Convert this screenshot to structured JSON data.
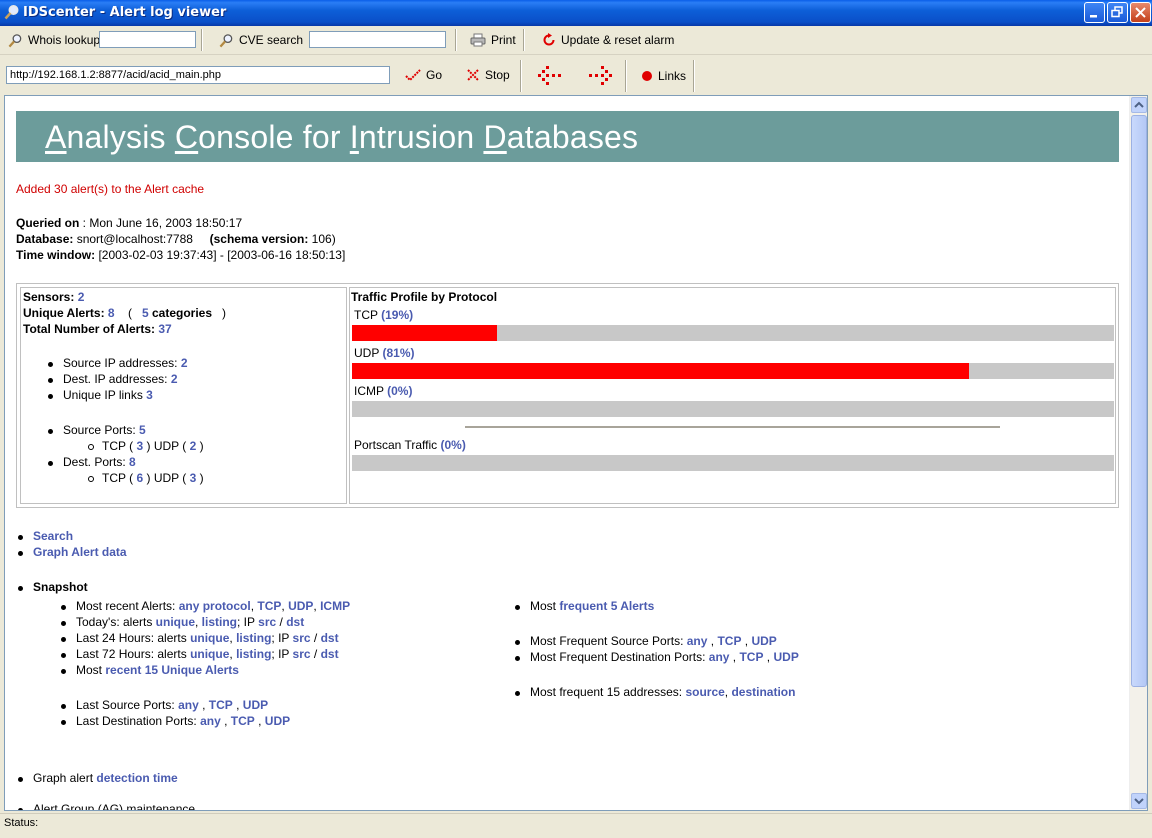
{
  "window": {
    "title": "IDScenter - Alert log viewer"
  },
  "toolbar1": {
    "whois_label": "Whois lookup",
    "whois_value": "",
    "cve_label": "CVE search",
    "cve_value": "",
    "print_label": "Print",
    "update_label": "Update & reset alarm"
  },
  "toolbar2": {
    "url": "http://192.168.1.2:8877/acid/acid_main.php",
    "go_label": "Go",
    "stop_label": "Stop",
    "links_label": "Links"
  },
  "acid": {
    "banner_title_parts": [
      "A",
      "nalysis ",
      "C",
      "onsole for ",
      "I",
      "ntrusion ",
      "D",
      "atabases"
    ],
    "cache_msg": "Added 30 alert(s) to the Alert cache",
    "queried_label": "Queried on",
    "queried_value": " : Mon June 16, 2003 18:50:17",
    "database_label": "Database:",
    "database_value": " snort@localhost:7788",
    "schema_label": "(schema version:",
    "schema_value": " 106)",
    "time_label": "Time window:",
    "time_value": " [2003-02-03 19:37:43] - [2003-06-16 18:50:13]",
    "stats": {
      "sensors_label": "Sensors:",
      "sensors_value": "2",
      "unique_label": "Unique Alerts:",
      "unique_value": "8",
      "categories_open": "(",
      "categories_value": "5",
      "categories_label": "categories",
      "categories_close": ")",
      "total_label": "Total Number of Alerts:",
      "total_value": "37",
      "src_ip_label": "Source IP addresses:",
      "src_ip_value": "2",
      "dst_ip_label": "Dest. IP addresses:",
      "dst_ip_value": "2",
      "ip_links_label": "Unique IP links",
      "ip_links_value": "3",
      "src_ports_label": "Source Ports:",
      "src_ports_value": "5",
      "src_tcp_label": "TCP (",
      "src_tcp_value": "3",
      "src_udp_label": ")  UDP (",
      "src_udp_value": "2",
      "dst_ports_label": "Dest. Ports:",
      "dst_ports_value": "8",
      "dst_tcp_label": "TCP (",
      "dst_tcp_value": "6",
      "dst_udp_label": ")  UDP (",
      "dst_udp_value": "3",
      "paren_close": ")"
    },
    "traffic": {
      "title": "Traffic Profile by Protocol",
      "tcp_label": "TCP",
      "tcp_pct": "(19%)",
      "tcp_fraction": 0.19,
      "udp_label": "UDP",
      "udp_pct": "(81%)",
      "udp_fraction": 0.81,
      "icmp_label": "ICMP",
      "icmp_pct": "(0%)",
      "icmp_fraction": 0.0,
      "portscan_label": "Portscan Traffic",
      "portscan_pct": "(0%)",
      "portscan_fraction": 0.0,
      "fill_color": "#ff0000",
      "track_color": "#c8c8c8"
    },
    "links": {
      "search": "Search",
      "graph": "Graph Alert data",
      "snapshot": "Snapshot",
      "most_recent_label": "Most recent Alerts:",
      "any_protocol": "any protocol",
      "tcp": "TCP",
      "udp": "UDP",
      "icmp": "ICMP",
      "todays_label": "Today's: alerts",
      "unique": "unique",
      "listing": "listing",
      "ip_label": "; IP",
      "src": "src",
      "dst": "dst",
      "last24_label": "Last 24 Hours: alerts",
      "last72_label": "Last 72 Hours: alerts",
      "most_label": "Most",
      "recent15": "recent 15 Unique Alerts",
      "last_src_ports_label": "Last Source Ports:",
      "any": "any",
      "last_dst_ports_label": "Last Destination Ports:",
      "most_freq5_label": "Most",
      "freq5": "frequent 5 Alerts",
      "most_freq_src_ports": "Most Frequent Source Ports:",
      "most_freq_dst_ports": "Most Frequent Destination Ports:",
      "most_freq15_label": "Most frequent 15 addresses:",
      "source": "source",
      "destination": "destination",
      "graph_alert_label": "Graph alert",
      "detection_time": "detection time",
      "cutoff_text": "Alert Group (AG) maintenance"
    }
  },
  "status": {
    "label": "Status:"
  }
}
